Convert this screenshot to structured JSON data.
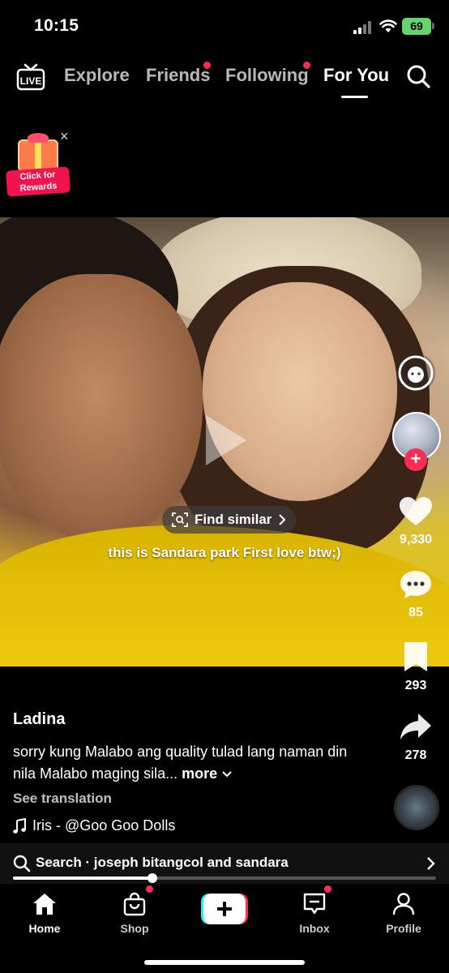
{
  "status_bar": {
    "time": "10:15",
    "battery": "69"
  },
  "top_nav": {
    "tabs": [
      {
        "label": "Explore",
        "dot": false,
        "active": false
      },
      {
        "label": "Friends",
        "dot": true,
        "active": false
      },
      {
        "label": "Following",
        "dot": true,
        "active": false
      },
      {
        "label": "For You",
        "dot": false,
        "active": true
      }
    ],
    "live_icon": "live-icon",
    "search_icon": "search-icon"
  },
  "rewards": {
    "label": "Click for Rewards",
    "close": "×"
  },
  "video": {
    "find_similar": "Find similar",
    "caption": "this is Sandara park First love btw;)"
  },
  "rail": {
    "likes": "9,330",
    "comments": "85",
    "saves": "293",
    "shares": "278"
  },
  "post": {
    "author": "Ladina",
    "description": "sorry kung Malabo ang quality tulad lang naman din nila Malabo maging sila...",
    "more_label": "more",
    "see_translation": "See translation",
    "music": "Iris - @Goo Goo Dolls"
  },
  "search_bar": {
    "text": "Search · joseph bitangcol and sandara",
    "progress": 0.33
  },
  "bottom_nav": {
    "items": [
      {
        "label": "Home",
        "active": true
      },
      {
        "label": "Shop",
        "active": false,
        "dot": true
      },
      {
        "label": "Inbox",
        "active": false,
        "dot": true
      },
      {
        "label": "Profile",
        "active": false
      }
    ]
  },
  "colors": {
    "accent": "#fe2c55",
    "battery": "#65d26e",
    "background": "#000000"
  }
}
